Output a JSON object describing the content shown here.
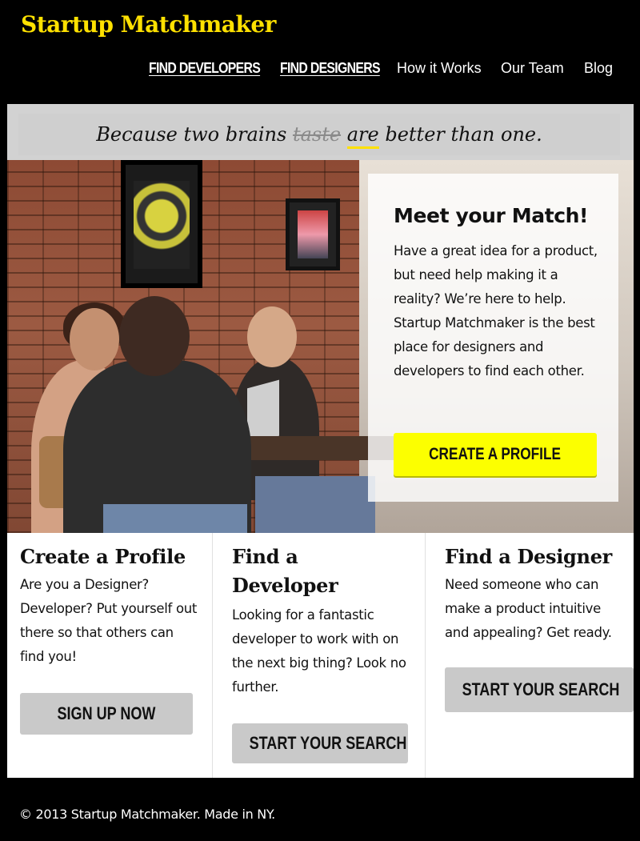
{
  "brand": {
    "title": "Startup Matchmaker"
  },
  "nav": {
    "items": [
      {
        "label": "FIND DEVELOPERS"
      },
      {
        "label": "FIND DESIGNERS"
      },
      {
        "label": "How it Works"
      },
      {
        "label": "Our Team"
      },
      {
        "label": "Blog"
      }
    ]
  },
  "tagline": {
    "before": "Because two brains",
    "struck": "taste",
    "underlined": "are",
    "after": "better than one."
  },
  "hero": {
    "title": "Meet your Match!",
    "body": "Have a great idea for a product, but need help making it a reality? We’re here to help. Startup Matchmaker is the best place for designers and developers to find each other.",
    "cta": "CREATE A PROFILE"
  },
  "columns": [
    {
      "title": "Create a Profile",
      "body": "Are you a Designer? Developer? Put yourself out there so that others can find you!",
      "button": "SIGN UP NOW"
    },
    {
      "title": "Find a Developer",
      "body": "Looking for a fantastic developer to work with on the next big thing? Look no further.",
      "button": "START YOUR SEARCH"
    },
    {
      "title": "Find a Designer",
      "body": "Need someone who can make a product intuitive and appealing? Get ready.",
      "button": "START YOUR SEARCH"
    }
  ],
  "footer": {
    "text": "© 2013 Startup Matchmaker. Made in NY."
  },
  "colors": {
    "brand_yellow": "#ffe100",
    "cta_yellow": "#fcff00",
    "header_bg": "#000000",
    "panel_gray": "#d2d2d2",
    "button_gray": "#c9c9c9"
  }
}
